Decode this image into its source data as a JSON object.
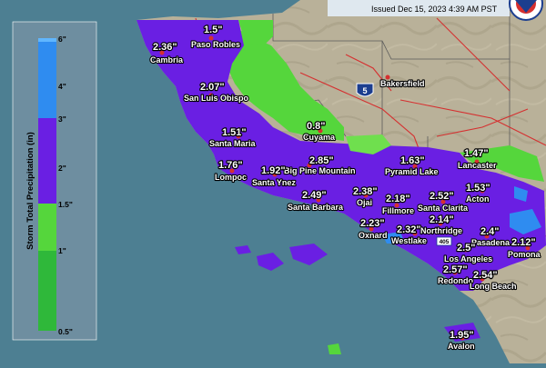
{
  "header": {
    "issued": "Issued Dec 15, 2023 4:39 AM PST"
  },
  "legend": {
    "title": "Storm Total Precipitation (in)",
    "ticks": [
      "6\"",
      "4\"",
      "3\"",
      "2\"",
      "1.5\"",
      "1\"",
      "0.5\""
    ]
  },
  "highway": {
    "shield": "5"
  },
  "places": [
    {
      "name": "Paso Robles",
      "amount": "1.5\""
    },
    {
      "name": "Cambria",
      "amount": "2.36\""
    },
    {
      "name": "San Luis Obispo",
      "amount": "2.07\""
    },
    {
      "name": "Bakersfield",
      "amount": ""
    },
    {
      "name": "Cuyama",
      "amount": "0.8\""
    },
    {
      "name": "Santa Maria",
      "amount": "1.51\""
    },
    {
      "name": "Big Pine Mountain",
      "amount": "2.85\""
    },
    {
      "name": "Lompoc",
      "amount": "1.76\""
    },
    {
      "name": "Santa Ynez",
      "amount": "1.92\""
    },
    {
      "name": "Santa Barbara",
      "amount": "2.49\""
    },
    {
      "name": "Pyramid Lake",
      "amount": "1.63\""
    },
    {
      "name": "Lancaster",
      "amount": "1.47\""
    },
    {
      "name": "Acton",
      "amount": "1.53\""
    },
    {
      "name": "Ojai",
      "amount": "2.38\""
    },
    {
      "name": "Fillmore",
      "amount": "2.18\""
    },
    {
      "name": "Santa Clarita",
      "amount": "2.52\""
    },
    {
      "name": "Oxnard",
      "amount": "2.23\""
    },
    {
      "name": "Westlake",
      "amount": "2.32\""
    },
    {
      "name": "Northridge",
      "amount": "2.14\""
    },
    {
      "name": "Pasadena",
      "amount": "2.4\""
    },
    {
      "name": "Pomona",
      "amount": "2.12\""
    },
    {
      "name": "Los Angeles",
      "amount": "2.5\""
    },
    {
      "name": "Redondo",
      "amount": "2.57\""
    },
    {
      "name": "Long Beach",
      "amount": "2.54\""
    },
    {
      "name": "Avalon",
      "amount": "1.95\""
    }
  ],
  "colors": {
    "ocean": "#4d7f92",
    "land": "#b5ad93",
    "green": "#55d63c",
    "lightgreen": "#89e96a",
    "purple": "#6a1fe3",
    "blue": "#2f8cf0",
    "legendBg": "#6e8ea0"
  }
}
